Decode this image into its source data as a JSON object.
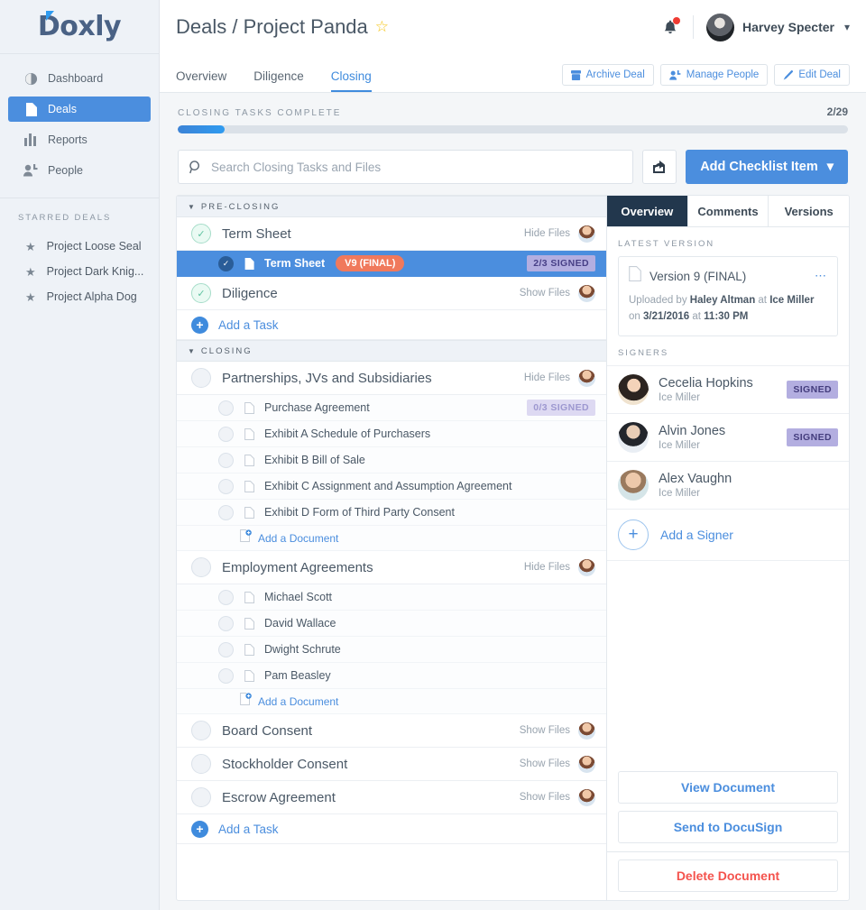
{
  "brand": {
    "name": "Doxly",
    "accent": "#4b8ede"
  },
  "sidebar": {
    "nav": [
      {
        "label": "Dashboard",
        "icon": "dashboard-icon"
      },
      {
        "label": "Deals",
        "icon": "document-icon"
      },
      {
        "label": "Reports",
        "icon": "bar-chart-icon"
      },
      {
        "label": "People",
        "icon": "people-icon"
      }
    ],
    "starred_header": "STARRED DEALS",
    "starred": [
      {
        "label": "Project Loose Seal"
      },
      {
        "label": "Project Dark Knig..."
      },
      {
        "label": "Project Alpha Dog"
      }
    ]
  },
  "header": {
    "title": "Deals / Project Panda",
    "star_glyph": "☆",
    "user_name": "Harvey Specter",
    "tabs": [
      {
        "label": "Overview",
        "active": false
      },
      {
        "label": "Diligence",
        "active": false
      },
      {
        "label": "Closing",
        "active": true
      }
    ],
    "buttons": [
      {
        "label": "Archive Deal",
        "icon": "archive-icon"
      },
      {
        "label": "Manage People",
        "icon": "people-icon"
      },
      {
        "label": "Edit Deal",
        "icon": "pencil-icon"
      }
    ]
  },
  "progress": {
    "label": "CLOSING TASKS COMPLETE",
    "count": "2/29",
    "percent": 7
  },
  "search": {
    "placeholder": "Search Closing Tasks and Files",
    "value": "",
    "share_icon": "share-icon",
    "add_button": "Add Checklist Item"
  },
  "checklist": {
    "sections": [
      {
        "title": "PRE-CLOSING",
        "tasks": [
          {
            "name": "Term Sheet",
            "done": true,
            "toggle": "Hide Files",
            "files": [
              {
                "name": "Term Sheet",
                "version_badge": "V9 (FINAL)",
                "signed_badge": "2/3 SIGNED",
                "selected": true,
                "checked": true
              }
            ]
          },
          {
            "name": "Diligence",
            "done": true,
            "toggle": "Show Files",
            "files": []
          }
        ],
        "add_task": "Add a Task"
      },
      {
        "title": "CLOSING",
        "tasks": [
          {
            "name": "Partnerships, JVs and Subsidiaries",
            "done": false,
            "toggle": "Hide Files",
            "files": [
              {
                "name": "Purchase Agreement",
                "signed_badge": "0/3 SIGNED"
              },
              {
                "name": "Exhibit A Schedule of Purchasers"
              },
              {
                "name": "Exhibit B Bill of Sale"
              },
              {
                "name": "Exhibit C Assignment and Assumption Agreement"
              },
              {
                "name": "Exhibit D Form of Third Party Consent"
              }
            ],
            "add_document": "Add a Document"
          },
          {
            "name": "Employment Agreements",
            "done": false,
            "toggle": "Hide Files",
            "files": [
              {
                "name": "Michael Scott"
              },
              {
                "name": "David Wallace"
              },
              {
                "name": "Dwight Schrute"
              },
              {
                "name": "Pam Beasley"
              }
            ],
            "add_document": "Add a Document"
          },
          {
            "name": "Board Consent",
            "done": false,
            "toggle": "Show Files",
            "files": []
          },
          {
            "name": "Stockholder Consent",
            "done": false,
            "toggle": "Show Files",
            "files": []
          },
          {
            "name": "Escrow Agreement",
            "done": false,
            "toggle": "Show Files",
            "files": []
          }
        ],
        "add_task": "Add a Task"
      }
    ]
  },
  "detail": {
    "tabs": [
      {
        "label": "Overview",
        "active": true
      },
      {
        "label": "Comments",
        "active": false
      },
      {
        "label": "Versions",
        "active": false
      }
    ],
    "latest_version_label": "LATEST VERSION",
    "version": {
      "title": "Version 9 (FINAL)",
      "uploaded_prefix": "Uploaded by ",
      "uploader": "Haley Altman",
      "at": " at ",
      "firm": "Ice Miller",
      "on": " on ",
      "date": "3/21/2016",
      "time_sep": " at ",
      "time": "11:30 PM"
    },
    "signers_label": "SIGNERS",
    "signers": [
      {
        "name": "Cecelia Hopkins",
        "firm": "Ice Miller",
        "status": "SIGNED"
      },
      {
        "name": "Alvin Jones",
        "firm": "Ice Miller",
        "status": "SIGNED"
      },
      {
        "name": "Alex Vaughn",
        "firm": "Ice Miller",
        "status": ""
      }
    ],
    "add_signer": "Add a Signer",
    "actions": [
      {
        "label": "View Document",
        "danger": false
      },
      {
        "label": "Send to DocuSign",
        "danger": false
      }
    ],
    "delete_action": {
      "label": "Delete Document",
      "danger": true
    }
  }
}
